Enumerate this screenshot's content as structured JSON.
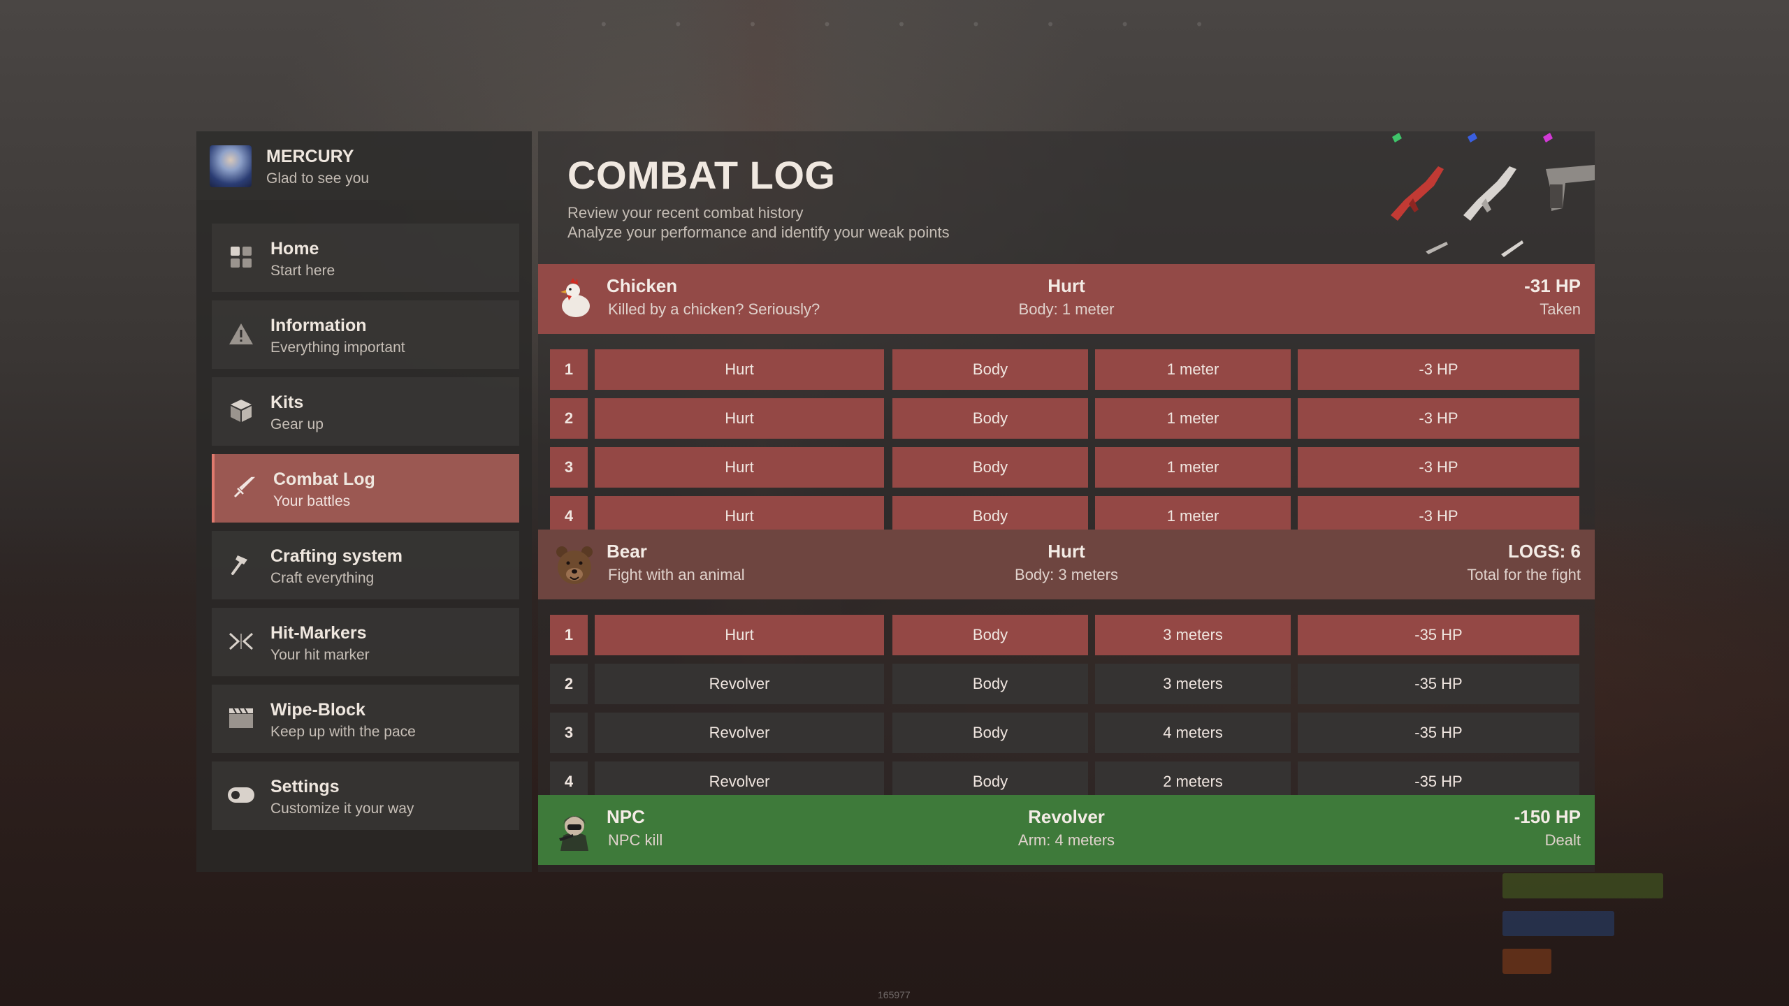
{
  "sidebar": {
    "profile": {
      "name": "MERCURY",
      "greeting": "Glad to see you"
    },
    "items": [
      {
        "title": "Home",
        "subtitle": "Start here",
        "icon": "grid-icon"
      },
      {
        "title": "Information",
        "subtitle": "Everything important",
        "icon": "warning-icon"
      },
      {
        "title": "Kits",
        "subtitle": "Gear up",
        "icon": "box-icon"
      },
      {
        "title": "Combat Log",
        "subtitle": "Your battles",
        "icon": "sword-icon",
        "active": true
      },
      {
        "title": "Crafting system",
        "subtitle": "Craft everything",
        "icon": "hammer-icon"
      },
      {
        "title": "Hit-Markers",
        "subtitle": "Your hit marker",
        "icon": "crosshair-icon"
      },
      {
        "title": "Wipe-Block",
        "subtitle": "Keep up with the pace",
        "icon": "clapperboard-icon"
      },
      {
        "title": "Settings",
        "subtitle": "Customize it your way",
        "icon": "toggle-icon"
      }
    ]
  },
  "main": {
    "title": "COMBAT LOG",
    "subtitle1": "Review your recent combat history",
    "subtitle2": "Analyze your performance and identify your weak points"
  },
  "fights": [
    {
      "name": "Chicken",
      "desc": "Killed by a chicken? Seriously?",
      "action": "Hurt",
      "detail": "Body: 1 meter",
      "right_main": "-31 HP",
      "right_sub": "Taken",
      "rows": [
        {
          "num": "1",
          "weapon": "Hurt",
          "part": "Body",
          "distance": "1 meter",
          "hp": "-3 HP",
          "style": "hit"
        },
        {
          "num": "2",
          "weapon": "Hurt",
          "part": "Body",
          "distance": "1 meter",
          "hp": "-3 HP",
          "style": "hit"
        },
        {
          "num": "3",
          "weapon": "Hurt",
          "part": "Body",
          "distance": "1 meter",
          "hp": "-3 HP",
          "style": "hit"
        },
        {
          "num": "4",
          "weapon": "Hurt",
          "part": "Body",
          "distance": "1 meter",
          "hp": "-3 HP",
          "style": "hit"
        }
      ]
    },
    {
      "name": "Bear",
      "desc": "Fight with an animal",
      "action": "Hurt",
      "detail": "Body: 3 meters",
      "right_main": "LOGS: 6",
      "right_sub": "Total for the fight",
      "rows": [
        {
          "num": "1",
          "weapon": "Hurt",
          "part": "Body",
          "distance": "3 meters",
          "hp": "-35 HP",
          "style": "hit"
        },
        {
          "num": "2",
          "weapon": "Revolver",
          "part": "Body",
          "distance": "3 meters",
          "hp": "-35 HP",
          "style": "plain"
        },
        {
          "num": "3",
          "weapon": "Revolver",
          "part": "Body",
          "distance": "4 meters",
          "hp": "-35 HP",
          "style": "plain"
        },
        {
          "num": "4",
          "weapon": "Revolver",
          "part": "Body",
          "distance": "2 meters",
          "hp": "-35 HP",
          "style": "plain"
        }
      ]
    },
    {
      "name": "NPC",
      "desc": "NPC kill",
      "action": "Revolver",
      "detail": "Arm: 4 meters",
      "right_main": "-150 HP",
      "right_sub": "Dealt",
      "rows": []
    }
  ],
  "footer_id": "165977",
  "colors": {
    "accent_active": "#9b5852",
    "hit_row": "#944845",
    "fight_taken": "#934a47",
    "fight_neutral": "#6e4540",
    "fight_dealt": "#3e7a3a"
  }
}
